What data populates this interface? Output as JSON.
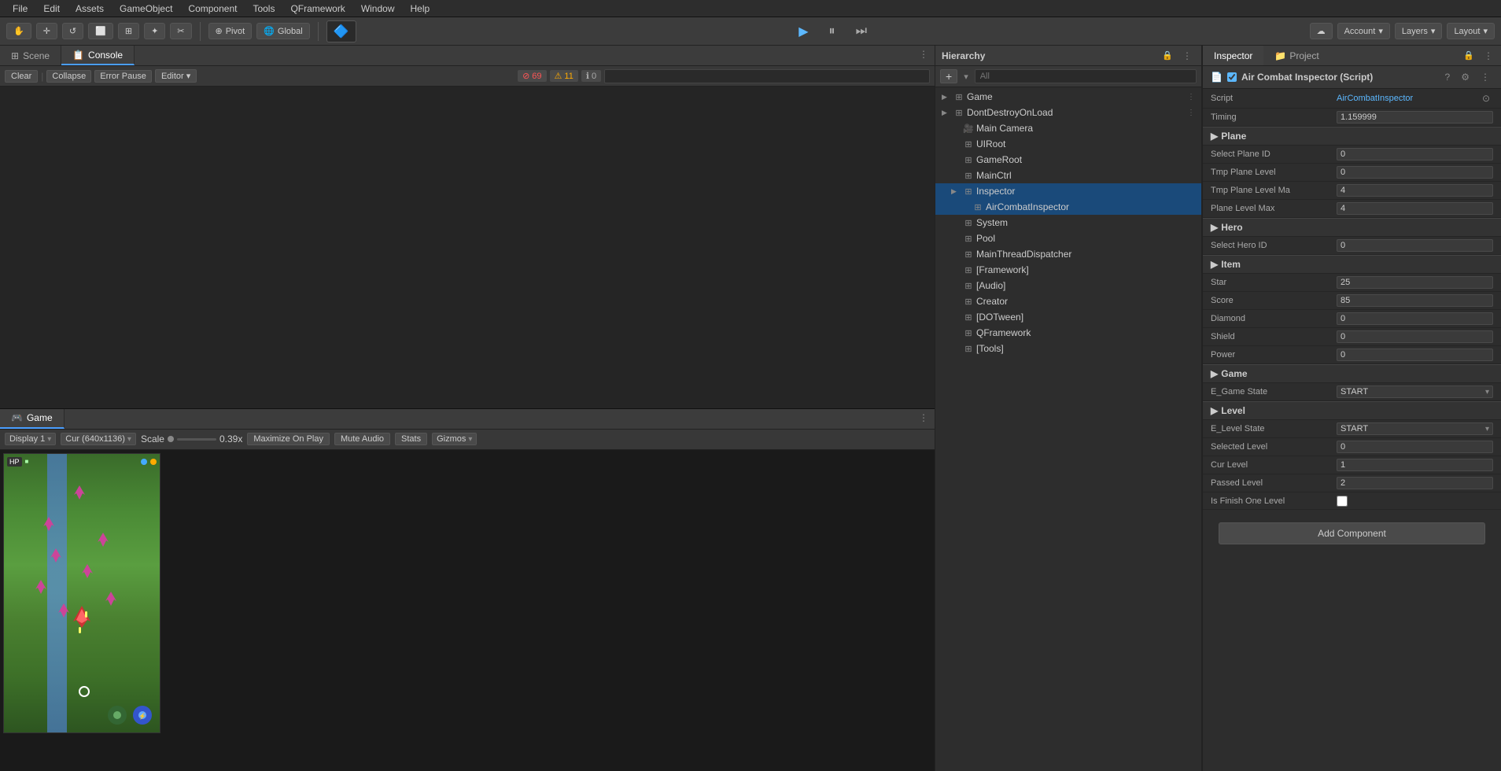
{
  "menu": {
    "items": [
      "File",
      "Edit",
      "Assets",
      "GameObject",
      "Component",
      "Tools",
      "QFramework",
      "Window",
      "Help"
    ]
  },
  "toolbar": {
    "tools": [
      "⊕",
      "⊕",
      "↺",
      "⬜",
      "⊞",
      "✦",
      "✂"
    ],
    "pivot_label": "Pivot",
    "global_label": "Global",
    "play_icon": "▶",
    "pause_icon": "⏸",
    "step_icon": "⏭",
    "cloud_icon": "☁",
    "account_label": "Account",
    "layers_label": "Layers",
    "layout_label": "Layout"
  },
  "console": {
    "tab_scene": "Scene",
    "tab_console": "Console",
    "clear_label": "Clear",
    "collapse_label": "Collapse",
    "error_pause_label": "Error Pause",
    "editor_label": "Editor",
    "error_count": "69",
    "warn_count": "11",
    "info_count": "0"
  },
  "game": {
    "tab_label": "Game",
    "display_label": "Display 1",
    "resolution_label": "Cur (640x1136)",
    "scale_label": "Scale",
    "scale_value": "0.39x",
    "maximize_label": "Maximize On Play",
    "mute_label": "Mute Audio",
    "stats_label": "Stats",
    "gizmos_label": "Gizmos"
  },
  "hierarchy": {
    "title": "Hierarchy",
    "search_placeholder": "All",
    "items": [
      {
        "label": "Game",
        "level": 0,
        "has_arrow": true,
        "expanded": true,
        "has_menu": true
      },
      {
        "label": "DontDestroyOnLoad",
        "level": 0,
        "has_arrow": true,
        "expanded": true,
        "has_menu": true
      },
      {
        "label": "Main Camera",
        "level": 1,
        "has_arrow": false
      },
      {
        "label": "UIRoot",
        "level": 1,
        "has_arrow": false
      },
      {
        "label": "GameRoot",
        "level": 1,
        "has_arrow": false
      },
      {
        "label": "MainCtrl",
        "level": 1,
        "has_arrow": false
      },
      {
        "label": "Inspector",
        "level": 1,
        "has_arrow": true,
        "expanded": true
      },
      {
        "label": "AirCombatInspector",
        "level": 2,
        "has_arrow": false
      },
      {
        "label": "System",
        "level": 1,
        "has_arrow": false
      },
      {
        "label": "Pool",
        "level": 1,
        "has_arrow": false
      },
      {
        "label": "MainThreadDispatcher",
        "level": 1,
        "has_arrow": false
      },
      {
        "label": "[Framework]",
        "level": 1,
        "has_arrow": false
      },
      {
        "label": "[Audio]",
        "level": 1,
        "has_arrow": false
      },
      {
        "label": "Creator",
        "level": 1,
        "has_arrow": false
      },
      {
        "label": "[DOTween]",
        "level": 1,
        "has_arrow": false
      },
      {
        "label": "QFramework",
        "level": 1,
        "has_arrow": false
      },
      {
        "label": "[Tools]",
        "level": 1,
        "has_arrow": false
      }
    ]
  },
  "inspector": {
    "tab_inspector": "Inspector",
    "tab_project": "Project",
    "component_name": "Air Combat Inspector (Script)",
    "script_label": "Script",
    "script_value": "AirCombatInspector",
    "timing_label": "Timing",
    "timing_value": "1.159999",
    "sections": {
      "plane": {
        "title": "Plane",
        "fields": [
          {
            "label": "Select Plane ID",
            "value": "0"
          },
          {
            "label": "Tmp Plane Level",
            "value": "0"
          },
          {
            "label": "Tmp Plane Level Ma",
            "value": "4"
          },
          {
            "label": "Plane Level Max",
            "value": "4"
          }
        ]
      },
      "hero": {
        "title": "Hero",
        "fields": [
          {
            "label": "Select Hero ID",
            "value": "0"
          }
        ]
      },
      "item": {
        "title": "Item",
        "fields": [
          {
            "label": "Star",
            "value": "25"
          },
          {
            "label": "Score",
            "value": "85"
          },
          {
            "label": "Diamond",
            "value": "0"
          },
          {
            "label": "Shield",
            "value": "0"
          },
          {
            "label": "Power",
            "value": "0"
          }
        ]
      },
      "game": {
        "title": "Game",
        "fields": [
          {
            "label": "E_Game State",
            "value": "START",
            "type": "dropdown"
          }
        ]
      },
      "level": {
        "title": "Level",
        "fields": [
          {
            "label": "E_Level State",
            "value": "START",
            "type": "dropdown"
          },
          {
            "label": "Selected Level",
            "value": "0"
          },
          {
            "label": "Cur Level",
            "value": "1"
          },
          {
            "label": "Passed Level",
            "value": "2"
          },
          {
            "label": "Is Finish One Level",
            "value": "",
            "type": "checkbox"
          }
        ]
      }
    },
    "add_component_label": "Add Component"
  }
}
